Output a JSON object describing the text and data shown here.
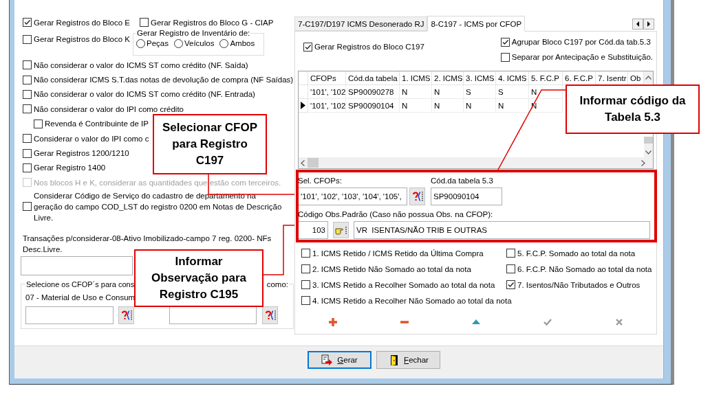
{
  "left_panel": {
    "bloco_row": [
      {
        "label": "Gerar Registros do Bloco E",
        "checked": true
      },
      {
        "label": "Gerar Registros do Bloco G - CIAP",
        "checked": false
      }
    ],
    "bloco_k": {
      "label": "Gerar Registros do Bloco K",
      "checked": false
    },
    "inventario": {
      "title": "Gerar Registro de Inventário de:",
      "options": [
        {
          "label": "Peças",
          "selected": false
        },
        {
          "label": "Veículos",
          "selected": false
        },
        {
          "label": "Ambos",
          "selected": false
        }
      ]
    },
    "options": [
      {
        "label": "Não considerar o valor do ICMS ST como crédito (NF. Saída)",
        "checked": false,
        "disabled": false
      },
      {
        "label": "Não considerar ICMS S.T.das notas de devolução de compra (NF Saídas)",
        "checked": false,
        "disabled": false
      },
      {
        "label": "Não considerar o valor do ICMS ST como crédito (NF. Entrada)",
        "checked": false,
        "disabled": false
      },
      {
        "label": "Não considerar o valor do IPI como crédito",
        "checked": false,
        "disabled": false,
        "children": [
          {
            "label": "Revenda é Contribuinte de IP",
            "checked": false,
            "disabled": false
          }
        ]
      },
      {
        "label": "Considerar o valor do IPI como c",
        "checked": false,
        "disabled": false
      },
      {
        "label": "Gerar Registros 1200/1210",
        "checked": false,
        "disabled": false
      },
      {
        "label": "Gerar Registro 1400",
        "checked": false,
        "disabled": false
      },
      {
        "label": "Nos blocos H e K, considerar as quantidades que estão com terceiros.",
        "checked": false,
        "disabled": true
      },
      {
        "label": "Considerar Código de Serviço do cadastro de departamento na geração do campo COD_LST do registro 0200 em Notas de Descrição Livre.",
        "checked": false,
        "disabled": false
      }
    ],
    "transacoes": {
      "label": "Transações p/considerar-08-Ativo Imobilizado-campo 7 reg. 0200- NFs Desc.Livre."
    },
    "cfop_group": {
      "title_start": "Selecione os CFOP´s para cons",
      "title_end": "como:",
      "label": "07 - Material de Uso e Consum"
    }
  },
  "tabs": [
    {
      "label": "7-C197/D197 ICMS Desonerado RJ",
      "selected": false
    },
    {
      "label": "8-C197 - ICMS por CFOP",
      "selected": true
    }
  ],
  "c197": {
    "gerar": {
      "label": "Gerar Registros do Bloco C197",
      "checked": true
    },
    "agrupar": {
      "label": "Agrupar Bloco C197 por Cód.da tab.5.3",
      "checked": true
    },
    "separar": {
      "label": "Separar por Antecipação e Substituição.",
      "checked": false
    }
  },
  "grid": {
    "columns": [
      "CFOPs",
      "Cód.da tabela",
      "1. ICMS",
      "2. ICMS",
      "3. ICMS",
      "4. ICMS",
      "5. F.C.P",
      "6. F.C.P",
      "7. Isentr",
      "Ob"
    ],
    "rows": [
      {
        "current": false,
        "cells": [
          "'101', '102",
          "SP90090278",
          "N",
          "N",
          "S",
          "S",
          "N"
        ]
      },
      {
        "current": true,
        "cells": [
          "'101', '102",
          "SP90090104",
          "N",
          "N",
          "N",
          "N",
          "N"
        ]
      }
    ]
  },
  "sel_cfops": {
    "label": "Sel. CFOPs:",
    "value": "'101', '102', '103', '104', '105',"
  },
  "cod_tabela": {
    "label": "Cód.da tabela 5.3",
    "value": "SP90090104"
  },
  "obs": {
    "label": "Código Obs.Padrão (Caso não possua Obs. na CFOP):",
    "code": "103",
    "description": "VR  ISENTAS/NÃO TRIB E OUTRAS"
  },
  "totals": [
    {
      "label": "1. ICMS Retido / ICMS Retido da Última Compra",
      "checked": false
    },
    {
      "label": "2. ICMS Retido Não Somado ao total da nota",
      "checked": false
    },
    {
      "label": "3. ICMS Retido a Recolher Somado ao total da nota",
      "checked": false
    },
    {
      "label": "4. ICMS Retido a Recolher Não Somado ao total da nota",
      "checked": false
    },
    {
      "label": "5. F.C.P. Somado ao total da nota",
      "checked": false
    },
    {
      "label": "6. F.C.P. Não Somado ao total da nota",
      "checked": false
    },
    {
      "label": "7. Isentos/Não Tributados e Outros",
      "checked": true
    }
  ],
  "toolbar": [
    {
      "kind": "add",
      "disabled": false
    },
    {
      "kind": "remove",
      "disabled": false
    },
    {
      "kind": "up",
      "disabled": false
    },
    {
      "kind": "confirm",
      "disabled": true
    },
    {
      "kind": "cancel",
      "disabled": true
    }
  ],
  "buttons": [
    {
      "kind": "generate",
      "label": "Gerar",
      "focused": true
    },
    {
      "kind": "close",
      "label": "Fechar",
      "focused": false
    }
  ],
  "callouts": [
    {
      "text": "Selecionar CFOP para Registro C197"
    },
    {
      "text": "Informar código da Tabela 5.3"
    },
    {
      "text": "Informar Observação para Registro C195"
    }
  ]
}
